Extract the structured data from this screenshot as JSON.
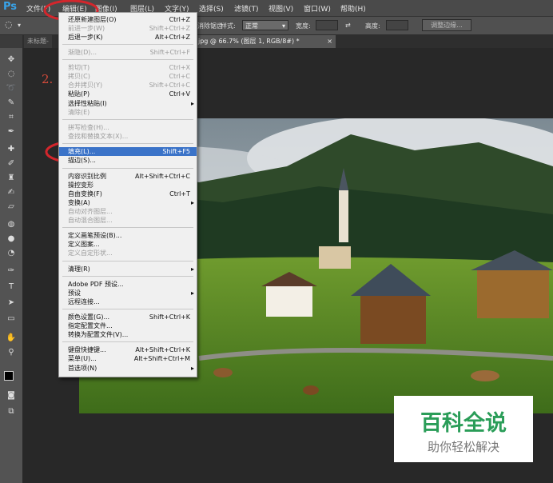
{
  "app": {
    "logo": "Ps"
  },
  "menubar": {
    "items": [
      {
        "label": "文件(F)"
      },
      {
        "label": "编辑(E)"
      },
      {
        "label": "图像(I)"
      },
      {
        "label": "图层(L)"
      },
      {
        "label": "文字(Y)"
      },
      {
        "label": "选择(S)"
      },
      {
        "label": "滤镜(T)"
      },
      {
        "label": "视图(V)"
      },
      {
        "label": "窗口(W)"
      },
      {
        "label": "帮助(H)"
      }
    ]
  },
  "options_bar": {
    "feather_partial": "消除锯齿",
    "style_label": "样式:",
    "style_value": "正常",
    "width_label": "宽度:",
    "height_label": "高度:",
    "refine_button": "调整边缘..."
  },
  "tabs": {
    "untitled": "未标题-",
    "doc": "jpg @ 66.7% (图层 1, RGB/8#) *",
    "close": "×"
  },
  "annotation": {
    "step": "2."
  },
  "edit_menu": {
    "items": [
      {
        "label": "还原新建图层(O)",
        "shortcut": "Ctrl+Z",
        "disabled": false
      },
      {
        "label": "前进一步(W)",
        "shortcut": "Shift+Ctrl+Z",
        "disabled": true
      },
      {
        "label": "后退一步(K)",
        "shortcut": "Alt+Ctrl+Z",
        "disabled": false
      },
      {
        "label": "渐隐(D)...",
        "shortcut": "Shift+Ctrl+F",
        "disabled": true
      },
      {
        "label": "剪切(T)",
        "shortcut": "Ctrl+X",
        "disabled": true
      },
      {
        "label": "拷贝(C)",
        "shortcut": "Ctrl+C",
        "disabled": true
      },
      {
        "label": "合并拷贝(Y)",
        "shortcut": "Shift+Ctrl+C",
        "disabled": true
      },
      {
        "label": "粘贴(P)",
        "shortcut": "Ctrl+V",
        "disabled": false
      },
      {
        "label": "选择性粘贴(I)",
        "shortcut": "",
        "disabled": false,
        "submenu": true
      },
      {
        "label": "清除(E)",
        "shortcut": "",
        "disabled": true
      },
      {
        "label": "拼写检查(H)...",
        "shortcut": "",
        "disabled": true
      },
      {
        "label": "查找和替换文本(X)...",
        "shortcut": "",
        "disabled": true
      },
      {
        "label": "填充(L)...",
        "shortcut": "Shift+F5",
        "disabled": false,
        "highlighted": true
      },
      {
        "label": "描边(S)...",
        "shortcut": "",
        "disabled": false
      },
      {
        "label": "内容识别比例",
        "shortcut": "Alt+Shift+Ctrl+C",
        "disabled": false
      },
      {
        "label": "操控变形",
        "shortcut": "",
        "disabled": false
      },
      {
        "label": "自由变换(F)",
        "shortcut": "Ctrl+T",
        "disabled": false
      },
      {
        "label": "变换(A)",
        "shortcut": "",
        "disabled": false,
        "submenu": true
      },
      {
        "label": "自动对齐图层...",
        "shortcut": "",
        "disabled": true
      },
      {
        "label": "自动混合图层...",
        "shortcut": "",
        "disabled": true
      },
      {
        "label": "定义画笔预设(B)...",
        "shortcut": "",
        "disabled": false
      },
      {
        "label": "定义图案...",
        "shortcut": "",
        "disabled": false
      },
      {
        "label": "定义自定形状...",
        "shortcut": "",
        "disabled": true
      },
      {
        "label": "清理(R)",
        "shortcut": "",
        "disabled": false,
        "submenu": true
      },
      {
        "label": "Adobe PDF 预设...",
        "shortcut": "",
        "disabled": false
      },
      {
        "label": "预设",
        "shortcut": "",
        "disabled": false,
        "submenu": true
      },
      {
        "label": "远程连接...",
        "shortcut": "",
        "disabled": false
      },
      {
        "label": "颜色设置(G)...",
        "shortcut": "Shift+Ctrl+K",
        "disabled": false
      },
      {
        "label": "指定配置文件...",
        "shortcut": "",
        "disabled": false
      },
      {
        "label": "转换为配置文件(V)...",
        "shortcut": "",
        "disabled": false
      },
      {
        "label": "键盘快捷键...",
        "shortcut": "Alt+Shift+Ctrl+K",
        "disabled": false
      },
      {
        "label": "菜单(U)...",
        "shortcut": "Alt+Shift+Ctrl+M",
        "disabled": false
      },
      {
        "label": "首选项(N)",
        "shortcut": "",
        "disabled": false,
        "submenu": true
      }
    ]
  },
  "watermark": {
    "title": "百科全说",
    "subtitle": "助你轻松解决"
  },
  "colors": {
    "accent_red": "#d4262c",
    "highlight": "#3b73c8",
    "watermark_green": "#2a9d58"
  }
}
